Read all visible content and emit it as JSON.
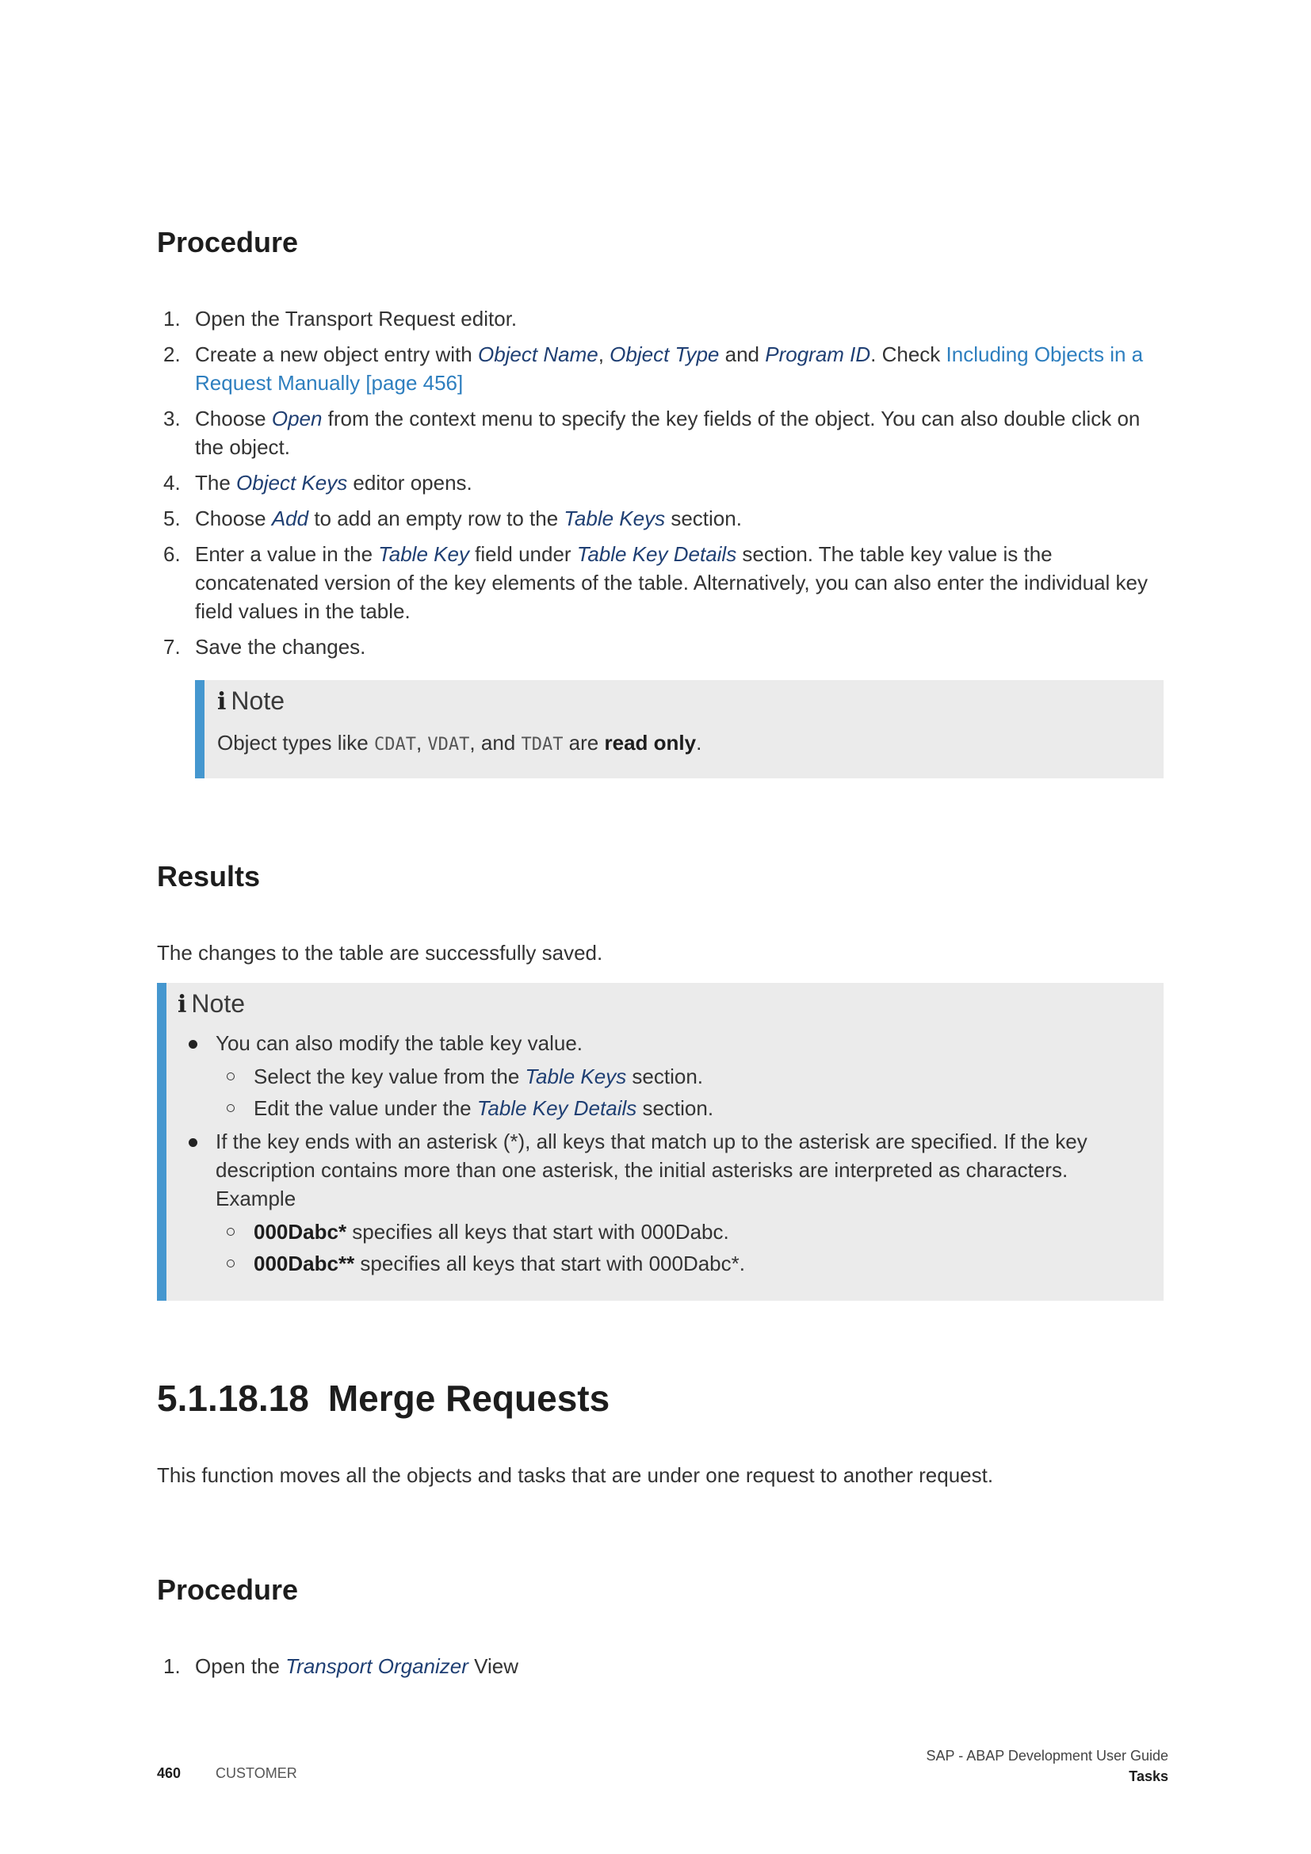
{
  "section1": {
    "procedure_heading": "Procedure",
    "steps": [
      {
        "n": "1.",
        "parts": [
          {
            "t": "Open the Transport Request editor."
          }
        ]
      },
      {
        "n": "2.",
        "parts": [
          {
            "t": "Create a new object entry with "
          },
          {
            "t": "Object Name",
            "s": "ui"
          },
          {
            "t": ", "
          },
          {
            "t": "Object Type",
            "s": "ui"
          },
          {
            "t": " and "
          },
          {
            "t": "Program ID",
            "s": "ui"
          },
          {
            "t": ". Check "
          },
          {
            "t": "Including Objects in a Request Manually [page 456]",
            "s": "xref"
          }
        ]
      },
      {
        "n": "3.",
        "parts": [
          {
            "t": "Choose "
          },
          {
            "t": "Open",
            "s": "ui"
          },
          {
            "t": " from the context menu to specify the key fields of the object. You can also double click on the object."
          }
        ]
      },
      {
        "n": "4.",
        "parts": [
          {
            "t": "The "
          },
          {
            "t": "Object Keys",
            "s": "ui"
          },
          {
            "t": " editor opens."
          }
        ]
      },
      {
        "n": "5.",
        "parts": [
          {
            "t": "Choose "
          },
          {
            "t": "Add",
            "s": "ui"
          },
          {
            "t": " to add an empty row to the "
          },
          {
            "t": "Table Keys",
            "s": "ui"
          },
          {
            "t": " section."
          }
        ]
      },
      {
        "n": "6.",
        "parts": [
          {
            "t": "Enter a value in the "
          },
          {
            "t": "Table Key",
            "s": "ui"
          },
          {
            "t": " field under "
          },
          {
            "t": "Table Key Details",
            "s": "ui"
          },
          {
            "t": " section. The table key value is the concatenated version of the key elements of the table. Alternatively, you can also enter the individual key field values in the table."
          }
        ]
      },
      {
        "n": "7.",
        "parts": [
          {
            "t": "Save the changes."
          }
        ]
      }
    ],
    "note1": {
      "icon": "i",
      "title": "Note",
      "parts": [
        {
          "t": "Object types like "
        },
        {
          "t": "CDAT",
          "s": "code"
        },
        {
          "t": ", "
        },
        {
          "t": "VDAT",
          "s": "code"
        },
        {
          "t": ", and "
        },
        {
          "t": "TDAT",
          "s": "code"
        },
        {
          "t": " are "
        },
        {
          "t": "read only",
          "s": "b"
        },
        {
          "t": "."
        }
      ]
    },
    "results_heading": "Results",
    "results_text": "The changes to the table are successfully saved.",
    "note2": {
      "icon": "i",
      "title": "Note",
      "bullets": [
        {
          "parts": [
            {
              "t": "You can also modify the table key value."
            }
          ],
          "sub": [
            {
              "parts": [
                {
                  "t": "Select the key value from the "
                },
                {
                  "t": "Table Keys",
                  "s": "ui"
                },
                {
                  "t": " section."
                }
              ]
            },
            {
              "parts": [
                {
                  "t": "Edit the value under the "
                },
                {
                  "t": "Table Key Details",
                  "s": "ui"
                },
                {
                  "t": " section."
                }
              ]
            }
          ]
        },
        {
          "parts": [
            {
              "t": "If the key ends with an asterisk (*), all keys that match up to the asterisk are specified. If the key description contains more than one asterisk, the initial asterisks are interpreted as characters. Example"
            }
          ],
          "sub": [
            {
              "parts": [
                {
                  "t": "000Dabc*",
                  "s": "b"
                },
                {
                  "t": " specifies all keys that start with 000Dabc."
                }
              ]
            },
            {
              "parts": [
                {
                  "t": "000Dabc**",
                  "s": "b"
                },
                {
                  "t": " specifies all keys that start with 000Dabc*."
                }
              ]
            }
          ]
        }
      ]
    }
  },
  "section2": {
    "number": "5.1.18.18",
    "title": "Merge Requests",
    "intro": "This function moves all the objects and tasks that are under one request to another request.",
    "procedure_heading": "Procedure",
    "steps": [
      {
        "n": "1.",
        "parts": [
          {
            "t": "Open the "
          },
          {
            "t": "Transport Organizer",
            "s": "ui"
          },
          {
            "t": " View"
          }
        ]
      }
    ]
  },
  "footer": {
    "page_number": "460",
    "classification": "CUSTOMER",
    "doc_title": "SAP - ABAP Development User Guide",
    "section_name": "Tasks"
  }
}
